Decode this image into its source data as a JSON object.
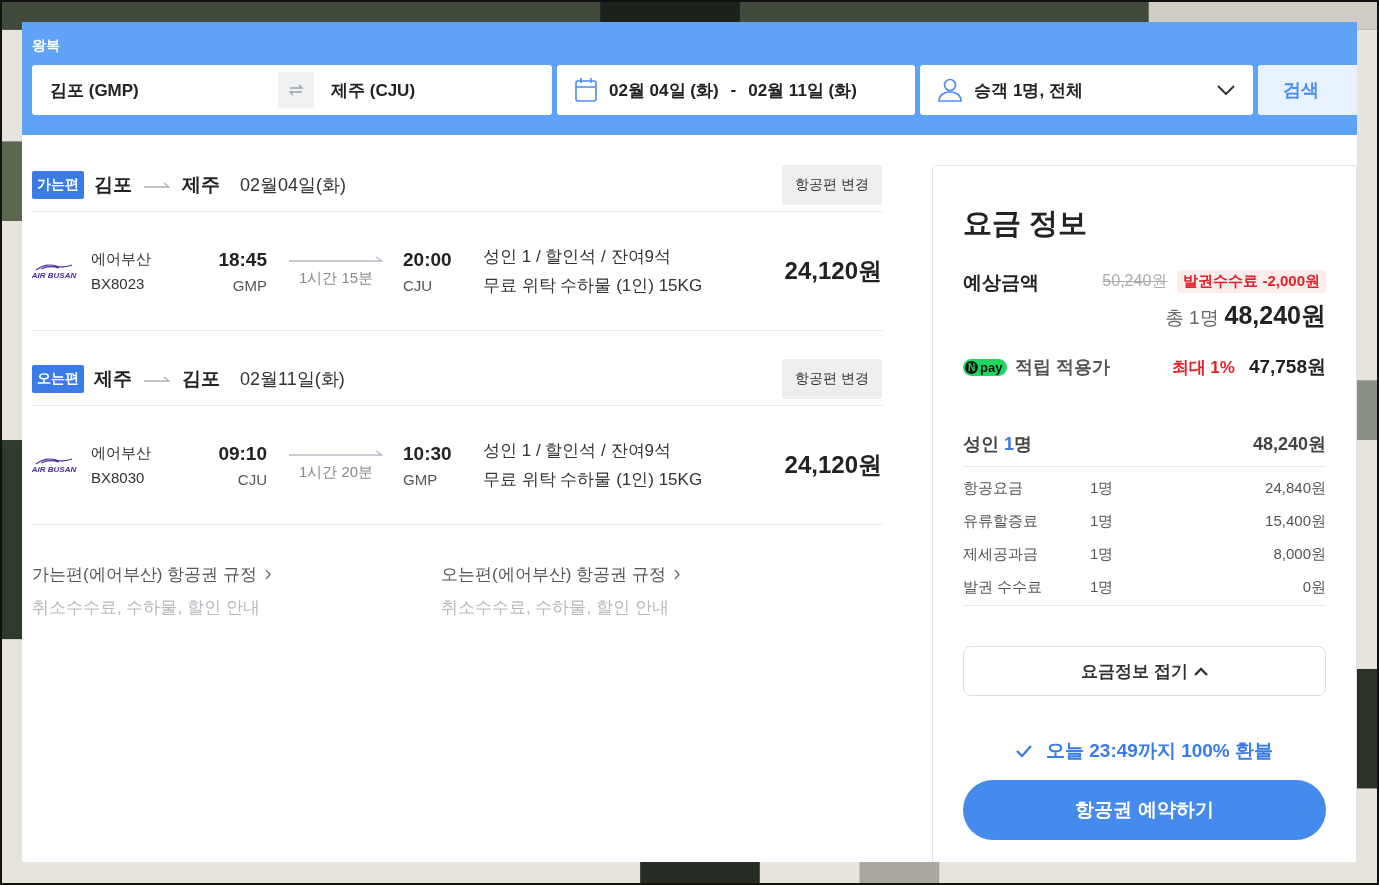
{
  "search": {
    "trip_type": "왕복",
    "origin": "김포 (GMP)",
    "destination": "제주 (CJU)",
    "depart_date": "02월 04일 (화)",
    "date_separator": "-",
    "return_date": "02월 11일 (화)",
    "passengers": "승객 1명, 전체",
    "search_button": "검색"
  },
  "segments": [
    {
      "badge": "가는편",
      "from": "김포",
      "to": "제주",
      "date": "02월04일(화)",
      "change_button": "항공편 변경",
      "logo_text": "AIR BUSAN",
      "airline": "에어부산",
      "flight_no": "BX8023",
      "dep_time": "18:45",
      "dep_code": "GMP",
      "duration": "1시간 15분",
      "arr_time": "20:00",
      "arr_code": "CJU",
      "seat_info": "성인 1 / 할인석 / 잔여9석",
      "baggage": "무료 위탁 수하물 (1인) 15KG",
      "price": "24,120원"
    },
    {
      "badge": "오는편",
      "from": "제주",
      "to": "김포",
      "date": "02월11일(화)",
      "change_button": "항공편 변경",
      "logo_text": "AIR BUSAN",
      "airline": "에어부산",
      "flight_no": "BX8030",
      "dep_time": "09:10",
      "dep_code": "CJU",
      "duration": "1시간 20분",
      "arr_time": "10:30",
      "arr_code": "GMP",
      "seat_info": "성인 1 / 할인석 / 잔여9석",
      "baggage": "무료 위탁 수하물 (1인) 15KG",
      "price": "24,120원"
    }
  ],
  "rules": [
    {
      "title": "가는편(에어부산) 항공권 규정",
      "subtitle": "취소수수료, 수하물, 할인 안내"
    },
    {
      "title": "오는편(에어부산) 항공권 규정",
      "subtitle": "취소수수료, 수하물, 할인 안내"
    }
  ],
  "fare": {
    "title": "요금 정보",
    "estimate_label": "예상금액",
    "original_price": "50,240원",
    "discount_badge": "발권수수료 -2,000원",
    "total_prefix": "총 1명",
    "total": "48,240원",
    "npay_logo_mark": "N",
    "npay_logo_text": "pay",
    "npay_label": "적립 적용가",
    "npay_max": "최대 1%",
    "npay_price": "47,758원",
    "adult_label": "성인",
    "adult_count": "1",
    "adult_unit": "명",
    "adult_total": "48,240원",
    "items": [
      {
        "name": "항공요금",
        "count": "1명",
        "amount": "24,840원"
      },
      {
        "name": "유류할증료",
        "count": "1명",
        "amount": "15,400원"
      },
      {
        "name": "제세공과금",
        "count": "1명",
        "amount": "8,000원"
      },
      {
        "name": "발권 수수료",
        "count": "1명",
        "amount": "0원"
      }
    ],
    "collapse_button": "요금정보 접기",
    "refund_note": "오늘 23:49까지 100% 환불",
    "book_button": "항공권 예약하기"
  }
}
